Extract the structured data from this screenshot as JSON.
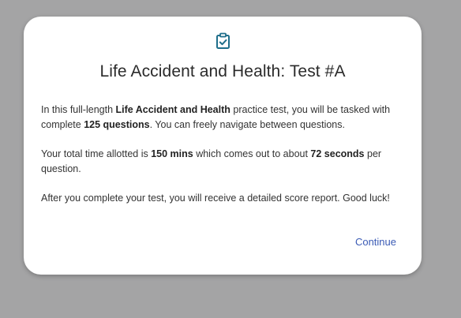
{
  "colors": {
    "backdrop": "#a4a4a5",
    "modal_bg": "#ffffff",
    "icon": "#1f6f8b",
    "link": "#3b5bb5"
  },
  "modal": {
    "icon": "clipboard-check-icon",
    "title": "Life Accident and Health: Test #A",
    "paragraph1": {
      "t1": "In this full-length ",
      "b1": "Life Accident and Health",
      "t2": " practice test, you will be tasked with complete ",
      "b2": "125 questions",
      "t3": ". You can freely navigate between questions."
    },
    "paragraph2": {
      "t1": "Your total time allotted is ",
      "b1": "150 mins",
      "t2": " which comes out to about ",
      "b2": "72 seconds",
      "t3": " per question."
    },
    "paragraph3": "After you complete your test, you will receive a detailed score report. Good luck!",
    "continue_label": "Continue"
  }
}
